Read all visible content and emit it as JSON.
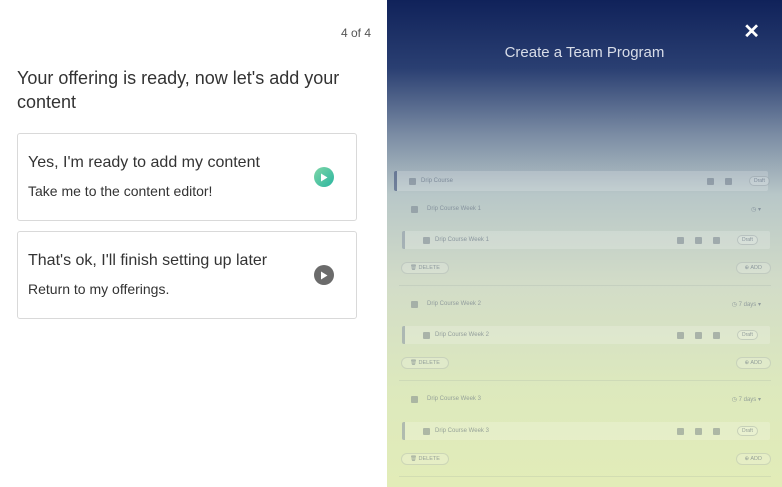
{
  "progress": {
    "step_text": "4 of 4"
  },
  "headline": "Your offering is ready, now let's add your content",
  "options": [
    {
      "title": "Yes, I'm ready to add my content",
      "subtitle": "Take me to the content editor!",
      "icon": "play-circle-icon",
      "color": "#2ab5a0"
    },
    {
      "title": "That's ok, I'll finish setting up later",
      "subtitle": "Return to my offerings.",
      "icon": "play-circle-icon",
      "color": "#6b6b6b"
    }
  ],
  "panel": {
    "title": "Create a Team Program",
    "close_icon": "close-icon",
    "course": {
      "name": "Drip Course",
      "status": "Draft"
    },
    "weeks": [
      {
        "name": "Drip Course Week 1",
        "days": "",
        "lesson": "Drip Course Week 1",
        "status": "Draft"
      },
      {
        "name": "Drip Course Week 2",
        "days": "7 days",
        "lesson": "Drip Course Week 2",
        "status": "Draft"
      },
      {
        "name": "Drip Course Week 3",
        "days": "7 days",
        "lesson": "Drip Course Week 3",
        "status": "Draft"
      }
    ],
    "delete_label": "DELETE",
    "add_label": "ADD"
  }
}
